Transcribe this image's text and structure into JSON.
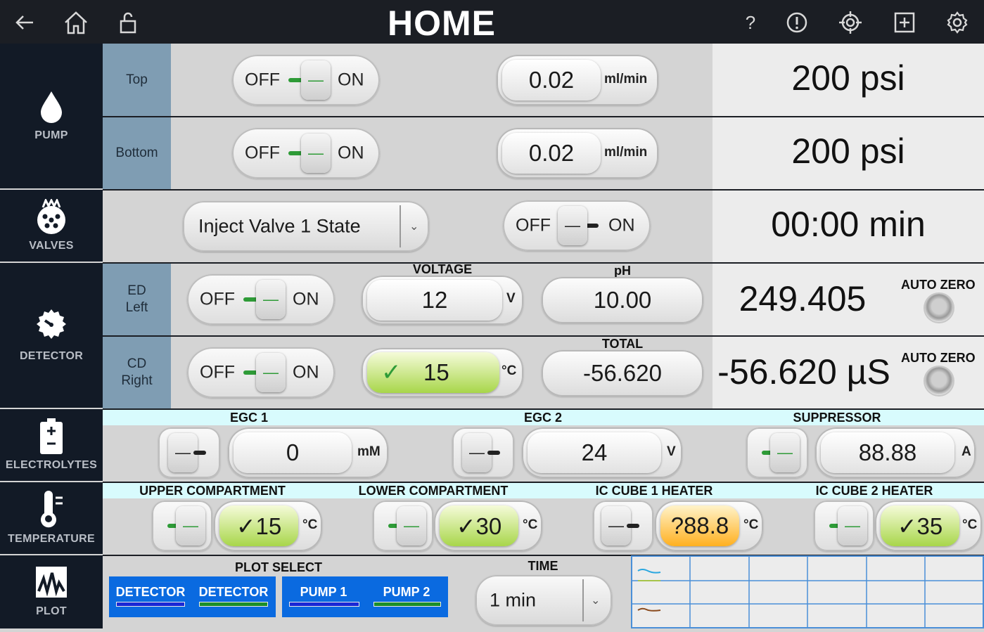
{
  "header": {
    "title": "HOME",
    "icons": [
      "back-arrow-icon",
      "home-icon",
      "unlock-icon",
      "help-icon",
      "alert-icon",
      "target-icon",
      "add-box-icon",
      "settings-gear-icon"
    ],
    "help_glyph": "?"
  },
  "sidebar": {
    "pump": "PUMP",
    "valves": "VALVES",
    "detector": "DETECTOR",
    "electrolytes": "ELECTROLYTES",
    "temperature": "TEMPERATURE",
    "plot": "PLOT"
  },
  "toggle_text": {
    "off": "OFF",
    "on": "ON",
    "knob": "—"
  },
  "pump": {
    "top": {
      "label": "Top",
      "flow": "0.02",
      "unit": "ml/min",
      "pressure": "200 psi"
    },
    "bottom": {
      "label": "Bottom",
      "flow": "0.02",
      "unit": "ml/min",
      "pressure": "200 psi"
    }
  },
  "valves": {
    "dropdown": "Inject Valve 1 State",
    "time": "00:00 min"
  },
  "detector": {
    "ed": {
      "label_line1": "ED",
      "label_line2": "Left",
      "voltage_header": "VOLTAGE",
      "voltage": "12",
      "voltage_unit": "V",
      "ph_header": "pH",
      "ph": "10.00",
      "reading": "249.405",
      "auto_zero": "AUTO ZERO"
    },
    "cd": {
      "label_line1": "CD",
      "label_line2": "Right",
      "temp_check": "✓",
      "temp": "15",
      "temp_unit": "°C",
      "total_header": "TOTAL",
      "total": "-56.620",
      "reading": "-56.620 µS",
      "auto_zero": "AUTO ZERO"
    }
  },
  "electrolytes": {
    "egc1": {
      "header": "EGC 1",
      "value": "0",
      "unit": "mM"
    },
    "egc2": {
      "header": "EGC 2",
      "value": "24",
      "unit": "V"
    },
    "suppressor": {
      "header": "SUPPRESSOR",
      "value": "88.88",
      "unit": "A"
    }
  },
  "temperature": {
    "upper": {
      "header": "UPPER COMPARTMENT",
      "value": "✓15",
      "unit": "°C"
    },
    "lower": {
      "header": "LOWER COMPARTMENT",
      "value": "✓30",
      "unit": "°C"
    },
    "cube1": {
      "header": "IC CUBE 1 HEATER",
      "value": "?88.8",
      "unit": "°C"
    },
    "cube2": {
      "header": "IC CUBE 2 HEATER",
      "value": "✓35",
      "unit": "°C"
    }
  },
  "plot": {
    "select_header": "PLOT SELECT",
    "buttons": [
      "DETECTOR",
      "DETECTOR",
      "PUMP 1",
      "PUMP 2"
    ],
    "time_header": "TIME",
    "time_value": "1 min"
  },
  "colors": {
    "topbar": "#1b1e24",
    "sidebar": "#121a26",
    "row_label": "#7f9db3",
    "plot_button": "#0a6ae0",
    "grid": "#4a8fd8"
  }
}
